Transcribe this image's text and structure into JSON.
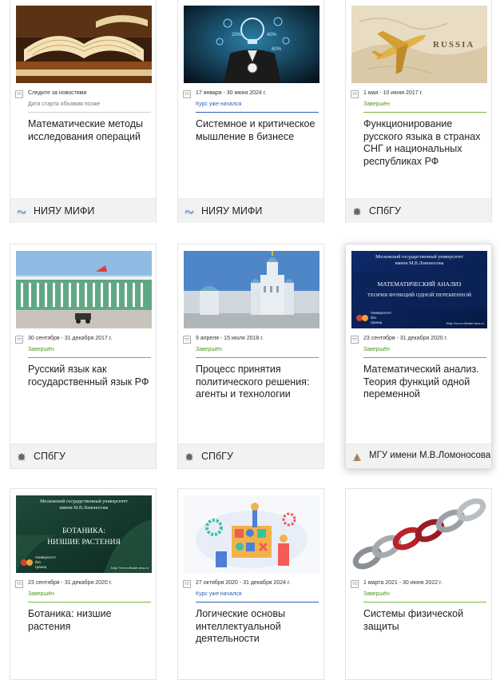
{
  "courses": [
    {
      "dates": "Следите за новостями",
      "status": "Дата старта объявим позже",
      "title": "Математические методы исследования операций",
      "university": "НИЯУ МИФИ",
      "image": "open-books-image",
      "status_color": "#777777"
    },
    {
      "dates": "17 января - 30 июня 2024 г.",
      "status": "Курс уже начался",
      "title": "Системное и критическое мышление в бизнесе",
      "university": "НИЯУ МИФИ",
      "image": "business-person-ideas-image",
      "status_color": "#2a63b8"
    },
    {
      "dates": "1 мая - 10 июня 2017 г.",
      "status": "Завершён",
      "title": "Функционирование русского языка в странах СНГ и национальных республиках РФ",
      "university": "СПбГУ",
      "image": "airplane-map-russia-image",
      "status_color": "#4e9a22",
      "map_word": "RUSSIA"
    },
    {
      "dates": "30 сентября - 31 декабря 2017 г.",
      "status": "Завершён",
      "title": "Русский язык как государственный язык РФ",
      "university": "СПбГУ",
      "image": "winter-palace-image",
      "status_color": "#4e9a22"
    },
    {
      "dates": "9 апреля - 15 июля 2018 г.",
      "status": "Завершён",
      "title": "Процесс принятия политического решения: агенты и технологии",
      "university": "СПбГУ",
      "image": "smolny-cathedral-image",
      "status_color": "#4e9a22"
    },
    {
      "dates": "23 сентября - 31 декабря 2020 г.",
      "status": "Завершён",
      "title": "Математический анализ. Теория функций одной переменной",
      "university": "МГУ имени М.В.Ломоносова",
      "image": "msu-math-banner-image",
      "status_color": "#4e9a22",
      "banner": {
        "header_line1": "Московский государственный университет",
        "header_line2": "имени М.В.Ломоносова",
        "main_line1": "МАТЕМАТИЧЕСКИЙ АНАЛИЗ",
        "main_line2": "ТЕОРИЯ ФУНКЦИЙ ОДНОЙ ПЕРЕМЕННОЙ",
        "logo_line1": "Университет",
        "logo_line2": "без",
        "logo_line3": "границ",
        "site": "http://www.distant.msu.ru"
      }
    },
    {
      "dates": "23 сентября - 31 декабря 2020 г.",
      "status": "Завершён",
      "title": "Ботаника: низшие растения",
      "university": "",
      "image": "msu-botany-banner-image",
      "status_color": "#4e9a22",
      "banner": {
        "header_line1": "Московский государственный университет",
        "header_line2": "имени М.В.Ломоносова",
        "main_line1": "БОТАНИКА:",
        "main_line2": "НИЗШИЕ РАСТЕНИЯ",
        "logo_line1": "Университет",
        "logo_line2": "без",
        "logo_line3": "границ",
        "site": "http://www.distant.msu.ru"
      }
    },
    {
      "dates": "27 октября 2020 - 31 декабря 2024 г.",
      "status": "Курс уже начался",
      "title": "Логические основы интеллектуальной деятельности",
      "university": "",
      "image": "logic-puzzle-illustration-image",
      "status_color": "#2a63b8"
    },
    {
      "dates": "1 марта 2021 - 30 июня 2022 г.",
      "status": "Завершён",
      "title": "Системы физической защиты",
      "university": "",
      "image": "chain-links-image",
      "status_color": "#4e9a22"
    }
  ]
}
